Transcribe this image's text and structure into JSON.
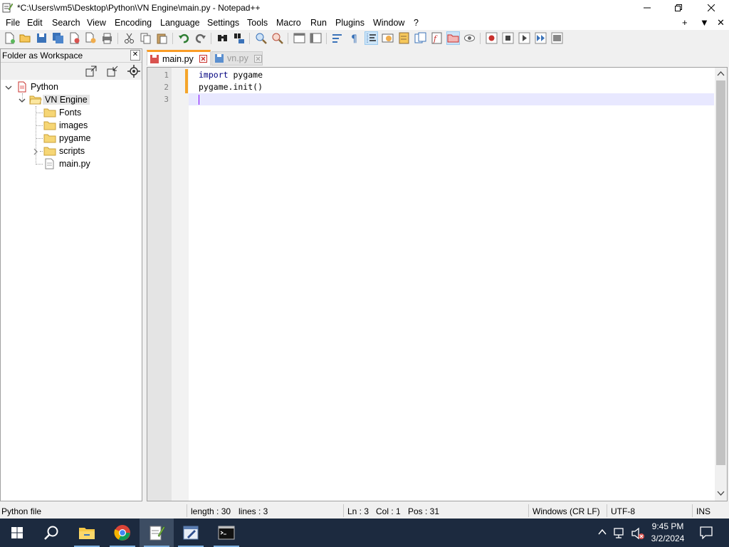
{
  "window": {
    "title": "*C:\\Users\\vm5\\Desktop\\Python\\VN Engine\\main.py - Notepad++",
    "controls": [
      "minimize-icon",
      "restore-icon",
      "close-icon"
    ]
  },
  "menubar": {
    "items": [
      "File",
      "Edit",
      "Search",
      "View",
      "Encoding",
      "Language",
      "Settings",
      "Tools",
      "Macro",
      "Run",
      "Plugins",
      "Window",
      "?"
    ],
    "right_icons": [
      "+",
      "▼",
      "✕"
    ]
  },
  "toolbar": {
    "icons": [
      "new-file-icon",
      "open-file-icon",
      "save-icon",
      "save-all-icon",
      "close-icon",
      "close-all-icon",
      "print-icon",
      "cut-icon",
      "copy-icon",
      "paste-icon",
      "undo-icon",
      "redo-icon",
      "find-icon",
      "replace-icon",
      "zoom-in-icon",
      "zoom-out-icon",
      "sync-v-icon",
      "sync-h-icon",
      "word-wrap-icon",
      "show-all-chars-icon",
      "indent-guide-icon",
      "udl-icon",
      "doc-map-icon",
      "doc-list-icon",
      "function-list-icon",
      "folder-workspace-icon",
      "monitoring-icon",
      "record-macro-icon",
      "stop-macro-icon",
      "play-macro-icon",
      "run-macro-multiple-icon",
      "save-macro-icon"
    ]
  },
  "panel": {
    "title": "Folder as Workspace",
    "tree": [
      {
        "label": "Python",
        "level": 0,
        "expanded": true,
        "type": "root"
      },
      {
        "label": "VN Engine",
        "level": 1,
        "expanded": true,
        "type": "folder",
        "selected": true
      },
      {
        "label": "Fonts",
        "level": 2,
        "type": "folder"
      },
      {
        "label": "images",
        "level": 2,
        "type": "folder"
      },
      {
        "label": "pygame",
        "level": 2,
        "type": "folder"
      },
      {
        "label": "scripts",
        "level": 2,
        "type": "folder",
        "collapsed": true
      },
      {
        "label": "main.py",
        "level": 2,
        "type": "file"
      }
    ]
  },
  "tabs": [
    {
      "label": "main.py",
      "active": true,
      "modified": true
    },
    {
      "label": "vn.py",
      "active": false,
      "modified": false
    }
  ],
  "editor": {
    "lines": [
      {
        "num": "1",
        "keyword": "import",
        "rest": " pygame"
      },
      {
        "num": "2",
        "keyword": "",
        "rest": "pygame.init()"
      },
      {
        "num": "3",
        "keyword": "",
        "rest": ""
      }
    ],
    "current_line": 3
  },
  "status": {
    "file_type": "Python file",
    "length": "length : 30",
    "lines": "lines : 3",
    "ln": "Ln : 3",
    "col": "Col : 1",
    "pos": "Pos : 31",
    "eol": "Windows (CR LF)",
    "encoding": "UTF-8",
    "mode": "INS"
  },
  "taskbar": {
    "apps": [
      "start-icon",
      "search-icon",
      "file-explorer-icon",
      "chrome-icon",
      "notepad-plus-plus-icon",
      "editor-app-icon",
      "terminal-icon"
    ],
    "time": "9:45 PM",
    "date": "3/2/2024"
  },
  "colors": {
    "accent": "#fa9c25",
    "keyword": "#00007f",
    "current_line": "#e8e8ff",
    "taskbar": "#1c2a3f"
  }
}
